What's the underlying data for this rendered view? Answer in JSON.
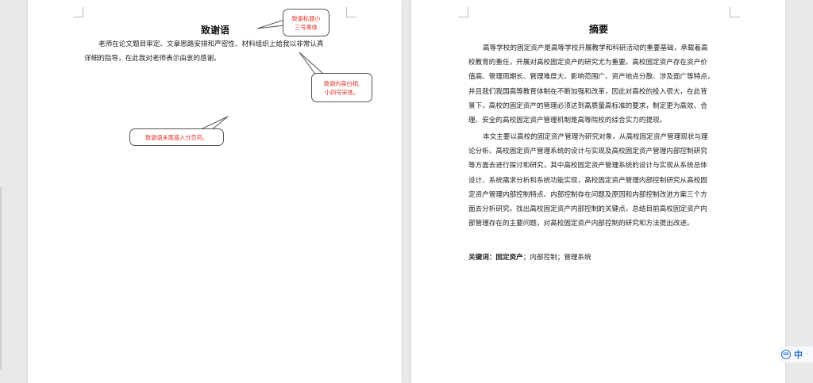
{
  "left_page": {
    "title": "致谢语",
    "body_lines": [
      "老师在论文题目审定、文章思路安排和严密性、材料组织上给我以非常认真",
      "详细的指导，在此我对老师表示由衷的感谢。"
    ],
    "callouts": [
      {
        "lines": [
          "致谢标题小",
          "三号黑体"
        ]
      },
      {
        "lines": [
          "致谢内容白相,",
          "小四号宋体。"
        ]
      },
      {
        "lines": [
          "致谢语末尾插入分页符。"
        ]
      }
    ]
  },
  "right_page": {
    "title": "摘要",
    "paragraphs": [
      [
        "高等学校的固定资产是高等学校开展教学和科研活动的重要基础，承载着高",
        "校教育的重任，开展对高校固定资产的研究尤为重要。高校固定资产存在资产价",
        "值高、管理周期长、管理难度大、影响范围广、资产地点分散、涉及面广等特点，",
        "并且我们我国高等教育体制在不断加强和改革，因此对高校的投入很大，在此背",
        "景下，高校的固定资产的管理必须达到高质量高标准的要求，制定更为高效、合",
        "理、安全的高校固定资产管理机制是高等院校的综合实力的提现。"
      ],
      [
        "本文主要以高校的固定资产管理为研究对象，从高校固定资产管理现状与理",
        "论分析、高校固定资产管理系统的设计与实现及高校固定资产管理内部控制研究",
        "等方面去进行探讨和研究，其中高校固定资产管理系统的设计与实现从系统总体",
        "设计、系统需求分析和系统功能实现，高校固定资产管理内部控制研究从高校固",
        "定资产管理内部控制特点、内部控制存在问题及原因和内部控制改进方案三个方",
        "面去分析研究。找出高校固定资产内部控制的关键点，总结目前高校固定资产内",
        "部管理存在的主要问题，对高校固定资产内部控制的研究和方法提出改进。"
      ]
    ],
    "keywords_label": "关键词：固定资产",
    "keywords_rest": "；内部控制；管理系统"
  },
  "status_bar": {
    "ime_icon": "⌨",
    "ime_label": "中",
    "ime_more": "·"
  },
  "colors": {
    "callout_text": "#e0322b",
    "ime_blue": "#2f6fd6"
  }
}
